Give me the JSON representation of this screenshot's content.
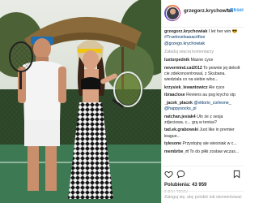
{
  "post": {
    "username": "grzegorz.krychowiak",
    "follow_label": "Obserwuj",
    "caption_text": "I let her win",
    "caption_tags": "#Truelovelsasacrifice",
    "caption_mention": "@grzego.krychowiak"
  },
  "comments_section": {
    "load_more": "Załaduj więcej komentarzy",
    "items": [
      {
        "user": "luxtorpednik",
        "text": "Masne cyce"
      },
      {
        "user": "nevermind.cat2012",
        "text": "To pewnie jej dekolt cie zdekoncentrowal, z Skubana. wiedziala co na siebie wloz..."
      },
      {
        "user": "krzysiek_lewantowicz",
        "text": "Ale cyce"
      },
      {
        "user": "ibraaclose",
        "text": "Reviens au psg krycho stp"
      },
      {
        "user": "_jacek_placek",
        "text": "@vittorio_corleone_ @happysocks_pl"
      },
      {
        "user": "natchan.jesiak4",
        "text": "Ulo że z sesja zdjeciowa. c... grą w tenisa?"
      },
      {
        "user": "tad.ek.grabowski",
        "text": "Just like in premier league..."
      },
      {
        "user": "tylesone",
        "text": "Przystojny ale wiesniak w c... "
      },
      {
        "user": "membrbe_rt",
        "text": "To do piłki zostaw wczas..."
      }
    ]
  },
  "actions": {
    "likes_label": "Polubienia",
    "likes_count": "43 959",
    "date": "3 dni temu",
    "add_comment_placeholder": "Zaloguj się, aby polubić lub skomentować"
  },
  "colors": {
    "link_blue": "#3897f0",
    "text_dark": "#262626",
    "muted": "#999999"
  },
  "icons": [
    "heart-icon",
    "comment-icon",
    "bookmark-icon"
  ]
}
